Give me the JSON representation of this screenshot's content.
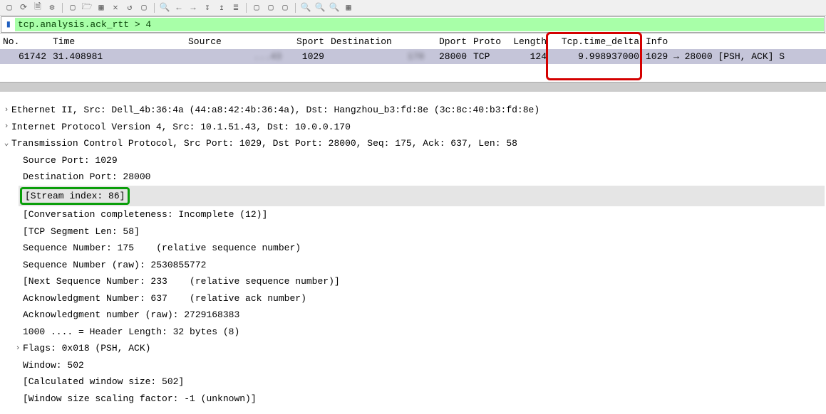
{
  "toolbar_icons": [
    "▢",
    "⟳",
    "≡",
    "⚙",
    "▢",
    "📁",
    "▦",
    "✕",
    "↺",
    "▢",
    "🔍",
    "←",
    "→",
    "↧",
    "↥",
    "≣",
    "▢",
    "▢",
    "▢",
    "🔍+",
    "🔍",
    "🔍-",
    "▦"
  ],
  "filter": {
    "text": "tcp.analysis.ack_rtt > 4"
  },
  "columns": {
    "no": "No.",
    "time": "Time",
    "source": "Source",
    "sport": "Sport",
    "destination": "Destination",
    "dport": "Dport",
    "proto": "Proto",
    "length": "Length",
    "delta": "Tcp.time_delta",
    "info": "Info"
  },
  "row": {
    "no": "61742",
    "time": "31.408981",
    "source": "      ...43",
    "sport": "1029",
    "destination": "         170",
    "dport": "28000",
    "proto": "TCP",
    "length": "124",
    "delta": "9.998937000",
    "info": "1029 → 28000 [PSH, ACK] S"
  },
  "details": {
    "eth": "Ethernet II, Src: Dell_4b:36:4a (44:a8:42:4b:36:4a), Dst: Hangzhou_b3:fd:8e (3c:8c:40:b3:fd:8e)",
    "ip": "Internet Protocol Version 4, Src: 10.1.51.43, Dst: 10.0.0.170",
    "tcp": "Transmission Control Protocol, Src Port: 1029, Dst Port: 28000, Seq: 175, Ack: 637, Len: 58",
    "srcport": "Source Port: 1029",
    "dstport": "Destination Port: 28000",
    "stream": "[Stream index: 86]",
    "conv": "[Conversation completeness: Incomplete (12)]",
    "seglen": "[TCP Segment Len: 58]",
    "seq": "Sequence Number: 175    (relative sequence number)",
    "seqraw": "Sequence Number (raw): 2530855772",
    "nextseq": "[Next Sequence Number: 233    (relative sequence number)]",
    "ack": "Acknowledgment Number: 637    (relative ack number)",
    "ackraw": "Acknowledgment number (raw): 2729168383",
    "hlen": "1000 .... = Header Length: 32 bytes (8)",
    "flags": "Flags: 0x018 (PSH, ACK)",
    "win": "Window: 502",
    "winc": "[Calculated window size: 502]",
    "winf": "[Window size scaling factor: -1 (unknown)]"
  }
}
